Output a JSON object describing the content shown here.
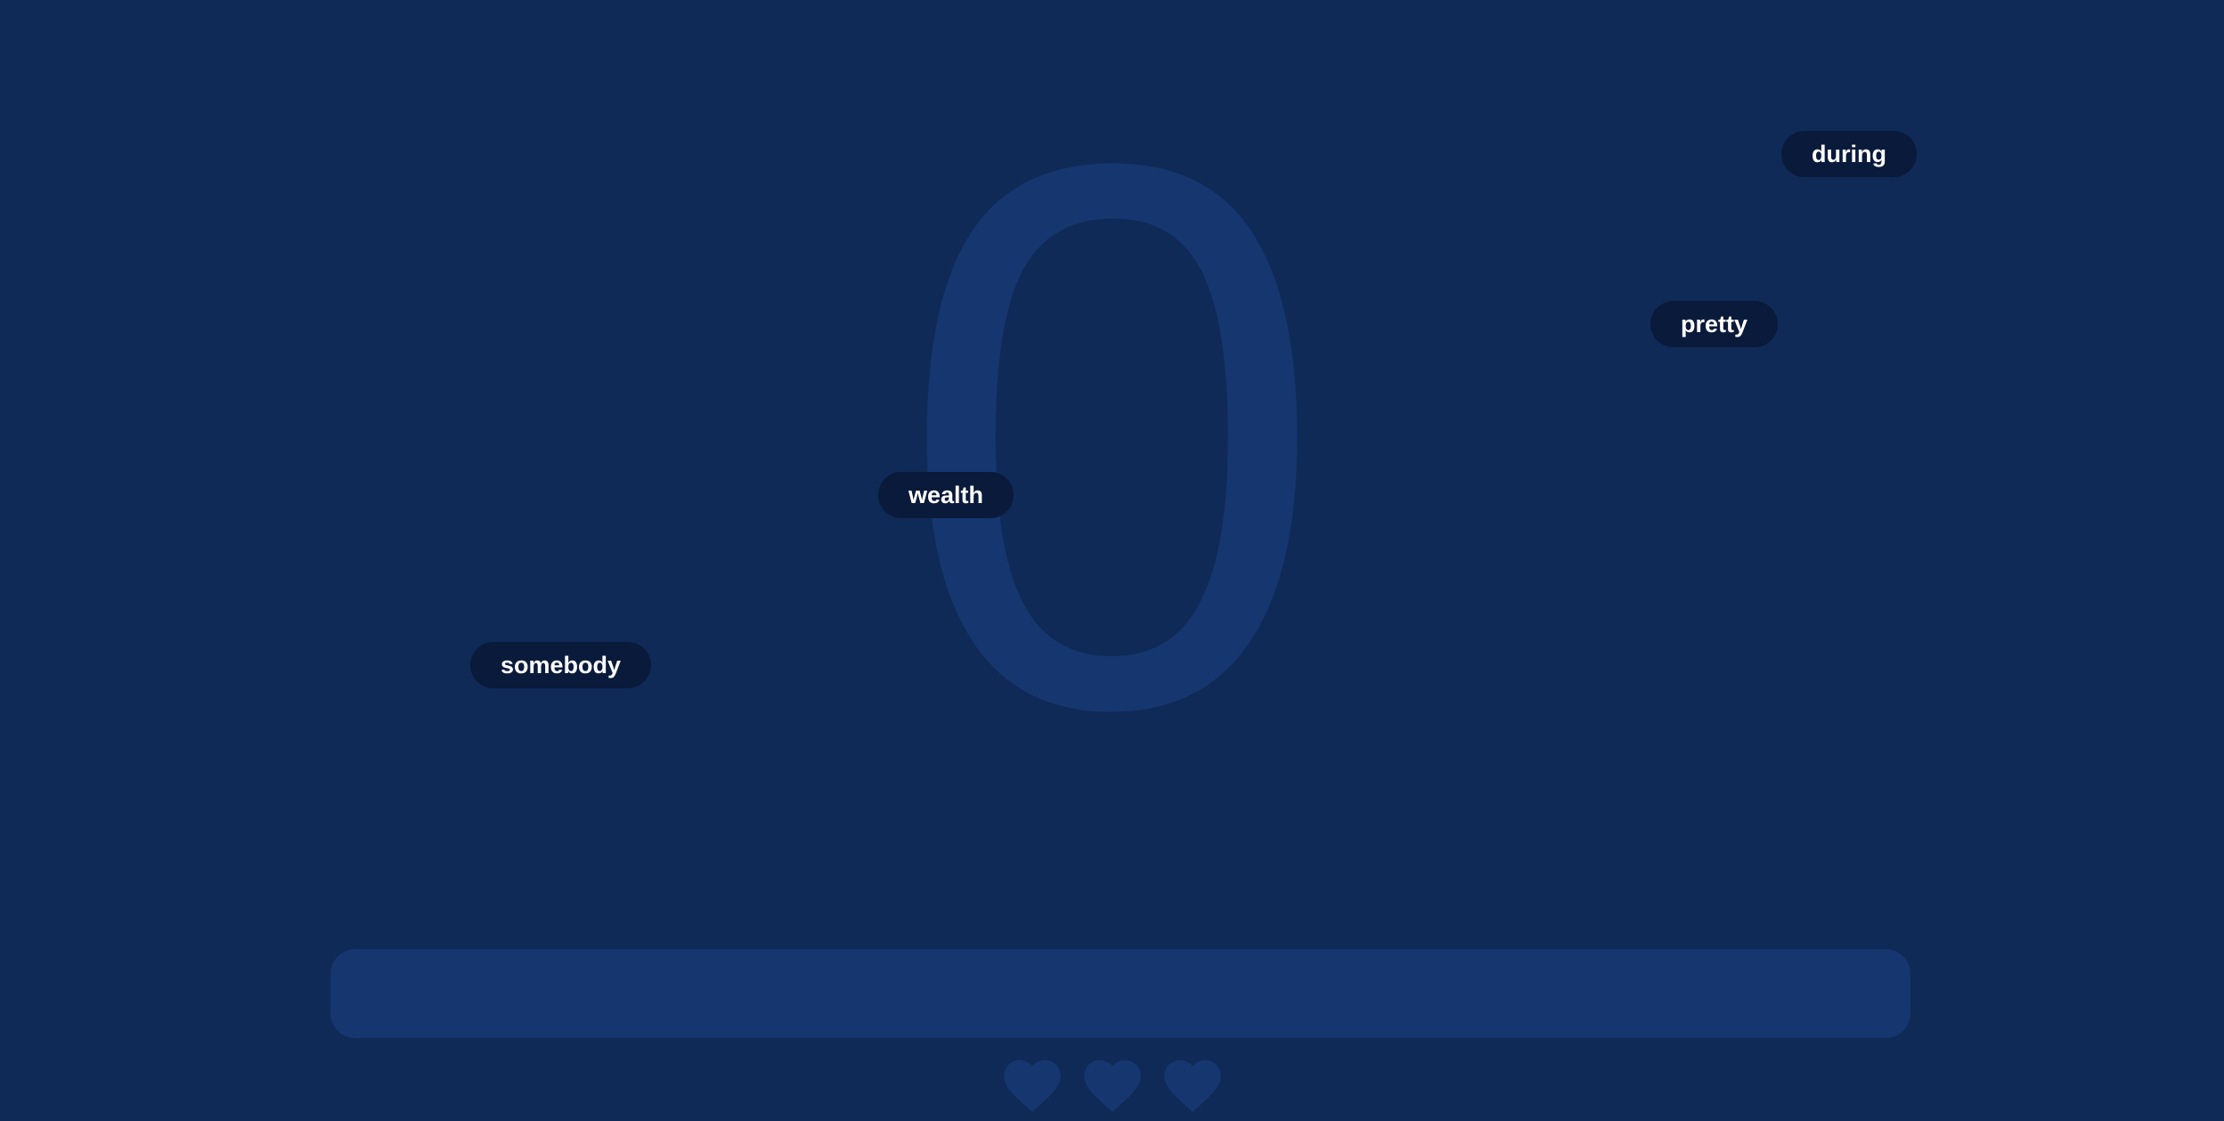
{
  "score": "0",
  "words": [
    {
      "text": "during"
    },
    {
      "text": "pretty"
    },
    {
      "text": "wealth"
    },
    {
      "text": "somebody"
    }
  ],
  "input": {
    "value": "",
    "placeholder": ""
  },
  "lives": {
    "remaining": 3,
    "icon": "heart-icon"
  },
  "colors": {
    "background": "#0f2a56",
    "score": "#16366f",
    "word_pill": "#0a1a3a",
    "word_text": "#ffffff",
    "input_bar": "#16366f",
    "heart": "#16366f"
  }
}
